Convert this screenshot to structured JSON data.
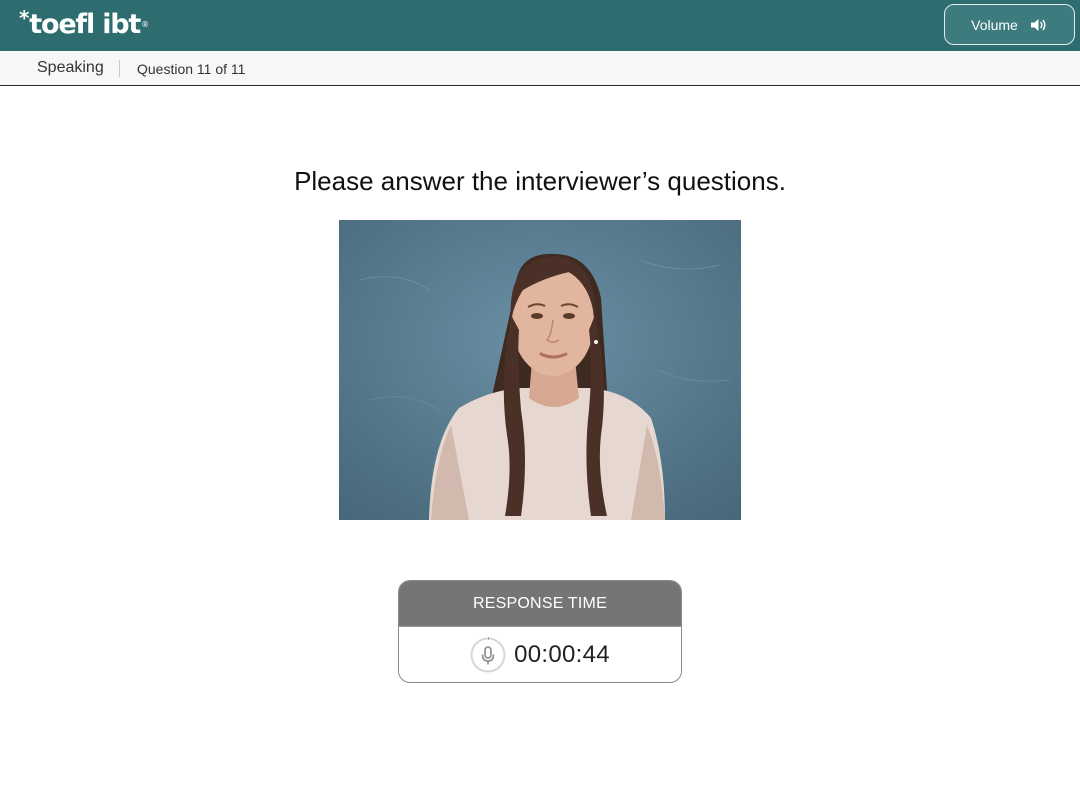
{
  "header": {
    "logo_star": "*",
    "logo_text": "toefl ibt",
    "logo_mark": "®",
    "volume_label": "Volume",
    "volume_icon": "speaker-icon"
  },
  "subheader": {
    "section": "Speaking",
    "question_counter": "Question 11 of 11"
  },
  "main": {
    "instruction": "Please answer the interviewer’s questions.",
    "video": {
      "subject": "interviewer"
    }
  },
  "response": {
    "title": "RESPONSE TIME",
    "time": "00:00:44",
    "icon": "microphone-icon"
  },
  "colors": {
    "header_bg": "#2d6c6f",
    "response_header_bg": "#757575",
    "video_bg": "#557b90"
  }
}
